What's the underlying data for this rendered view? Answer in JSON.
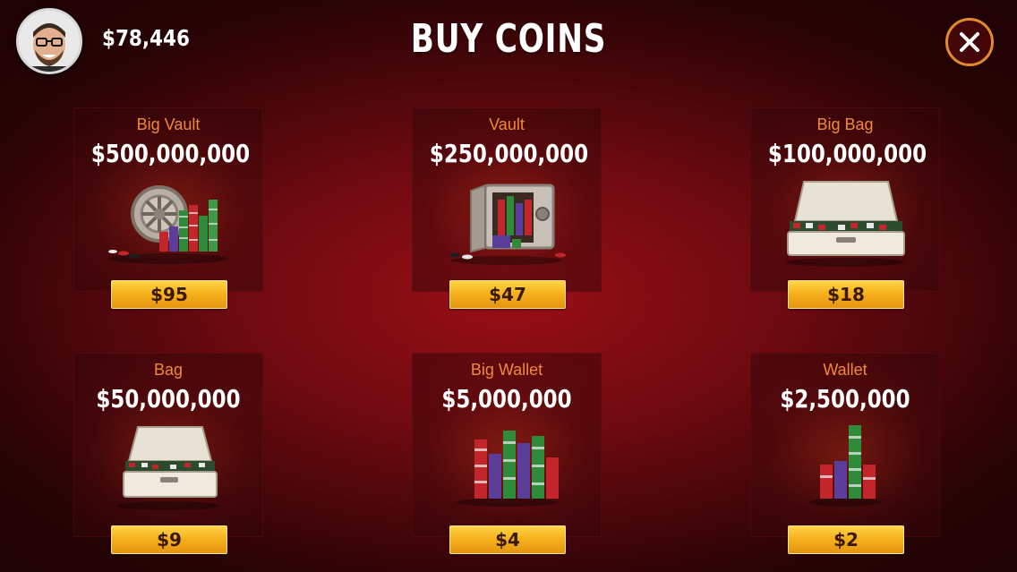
{
  "header": {
    "balance": "$78,446",
    "title": "BUY COINS"
  },
  "colors": {
    "background": "#6d0a10",
    "package_name": "#f08a3a",
    "price_button": "#f6b21d",
    "close_ring": "#e38a2a"
  },
  "packages": [
    {
      "name": "Big Vault",
      "amount": "$500,000,000",
      "price": "$95",
      "icon": "big-vault-icon"
    },
    {
      "name": "Vault",
      "amount": "$250,000,000",
      "price": "$47",
      "icon": "vault-icon"
    },
    {
      "name": "Big Bag",
      "amount": "$100,000,000",
      "price": "$18",
      "icon": "big-bag-icon"
    },
    {
      "name": "Bag",
      "amount": "$50,000,000",
      "price": "$9",
      "icon": "bag-icon"
    },
    {
      "name": "Big Wallet",
      "amount": "$5,000,000",
      "price": "$4",
      "icon": "big-wallet-chips-icon"
    },
    {
      "name": "Wallet",
      "amount": "$2,500,000",
      "price": "$2",
      "icon": "wallet-chips-icon"
    }
  ]
}
